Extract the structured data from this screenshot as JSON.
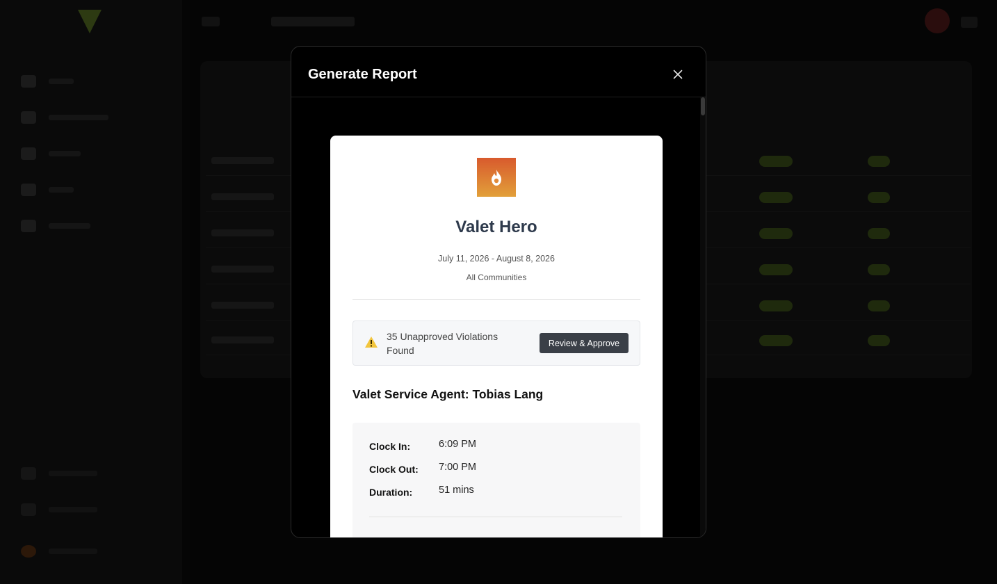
{
  "modal": {
    "title": "Generate Report",
    "close_icon": "close-icon"
  },
  "report": {
    "brand_logo_icon": "flame-icon",
    "brand_name": "Valet Hero",
    "date_range": "July 11, 2026 - August 8, 2026",
    "scope": "All Communities",
    "alert": {
      "icon": "warning-icon",
      "message": "35 Unapproved Violations Found",
      "button_label": "Review & Approve"
    },
    "agent_heading": "Valet Service Agent: Tobias Lang",
    "shift": [
      {
        "label": "Clock In:",
        "value": "6:09 PM"
      },
      {
        "label": "Clock Out:",
        "value": "7:00 PM"
      },
      {
        "label": "Duration:",
        "value": "51 mins"
      }
    ]
  },
  "colors": {
    "brand_gradient_top": "#d85a2d",
    "brand_gradient_bottom": "#e2a03a",
    "overlay": "#000000",
    "button_dark": "#3a3f47"
  }
}
